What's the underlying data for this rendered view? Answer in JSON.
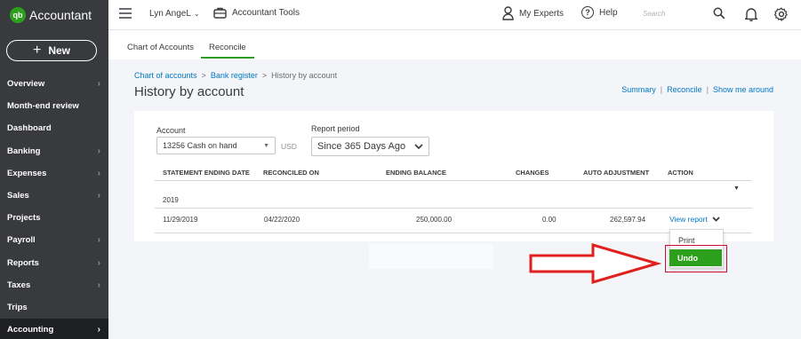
{
  "sidebar": {
    "logo_badge": "qb",
    "logo_text": "Accountant",
    "new_label": "New",
    "items": [
      {
        "label": "Overview",
        "chevron": true
      },
      {
        "label": "Month-end review",
        "chevron": false
      },
      {
        "label": "Dashboard",
        "chevron": false
      },
      {
        "label": "Banking",
        "chevron": true
      },
      {
        "label": "Expenses",
        "chevron": true
      },
      {
        "label": "Sales",
        "chevron": true
      },
      {
        "label": "Projects",
        "chevron": false
      },
      {
        "label": "Payroll",
        "chevron": true
      },
      {
        "label": "Reports",
        "chevron": true
      },
      {
        "label": "Taxes",
        "chevron": true
      },
      {
        "label": "Trips",
        "chevron": false
      },
      {
        "label": "Accounting",
        "chevron": true,
        "active": true
      }
    ]
  },
  "topbar": {
    "company": "Lyn AngeL",
    "tools": "Accountant Tools",
    "experts": "My Experts",
    "help": "Help",
    "search_placeholder": "Search"
  },
  "tabs": [
    {
      "label": "Chart of Accounts"
    },
    {
      "label": "Reconcile",
      "active": true
    }
  ],
  "breadcrumb": {
    "crumb1": "Chart of accounts",
    "crumb2": "Bank register",
    "current": "History by account"
  },
  "page_title": "History by account",
  "header_links": {
    "summary": "Summary",
    "reconcile": "Reconcile",
    "show_me": "Show me around"
  },
  "filters": {
    "account_label": "Account",
    "account_value": "13256 Cash on hand",
    "currency": "USD",
    "period_label": "Report period",
    "period_value": "Since 365 Days Ago"
  },
  "table": {
    "headers": [
      "STATEMENT ENDING DATE",
      "RECONCILED ON",
      "ENDING BALANCE",
      "CHANGES",
      "AUTO ADJUSTMENT",
      "ACTION"
    ],
    "group": "2019",
    "rows": [
      {
        "statement_date": "11/29/2019",
        "reconciled_on": "04/22/2020",
        "ending_balance": "250,000.00",
        "changes": "0.00",
        "auto_adjustment": "262,597.94",
        "action": "View report"
      }
    ]
  },
  "action_menu": {
    "print": "Print",
    "undo": "Undo"
  },
  "colors": {
    "brand_green": "#2ca01c",
    "link_blue": "#0077c5",
    "sidebar_bg": "#393a3d",
    "highlight_red": "#c8102e"
  }
}
